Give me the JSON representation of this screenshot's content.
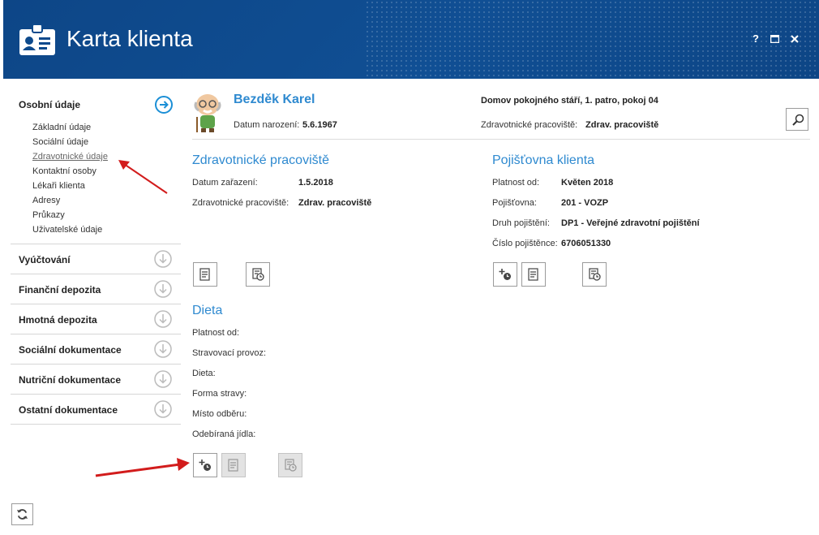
{
  "header": {
    "title": "Karta klienta",
    "help": "?",
    "maximize": "□",
    "close": "✕"
  },
  "sidebar": {
    "sections": [
      {
        "label": "Osobní údaje",
        "items": [
          "Základní údaje",
          "Sociální údaje",
          "Zdravotnické údaje",
          "Kontaktní osoby",
          "Lékaři klienta",
          "Adresy",
          "Průkazy",
          "Uživatelské údaje"
        ],
        "active": "Zdravotnické údaje"
      },
      {
        "label": "Vyúčtování"
      },
      {
        "label": "Finanční depozita"
      },
      {
        "label": "Hmotná depozita"
      },
      {
        "label": "Sociální dokumentace"
      },
      {
        "label": "Nutriční dokumentace"
      },
      {
        "label": "Ostatní dokumentace"
      }
    ]
  },
  "client": {
    "name": "Bezděk Karel",
    "dob_label": "Datum narození:",
    "dob": "5.6.1967",
    "location": "Domov pokojného stáří, 1. patro, pokoj 04",
    "workplace_label": "Zdravotnické pracoviště:",
    "workplace": "Zdrav. pracoviště"
  },
  "health": {
    "title": "Zdravotnické pracoviště",
    "date_label": "Datum zařazení:",
    "date": "1.5.2018",
    "wp_label": "Zdravotnické pracoviště:",
    "wp": "Zdrav. pracoviště"
  },
  "insurance": {
    "title": "Pojišťovna klienta",
    "valid_label": "Platnost od:",
    "valid": "Květen 2018",
    "company_label": "Pojišťovna:",
    "company": "201 - VOZP",
    "type_label": "Druh pojištění:",
    "type": "DP1 - Veřejné zdravotní pojištění",
    "number_label": "Číslo pojištěnce:",
    "number": "6706051330"
  },
  "diet": {
    "title": "Dieta",
    "fields": [
      "Platnost od:",
      "Stravovací provoz:",
      "Dieta:",
      "Forma stravy:",
      "Místo odběru:",
      "Odebíraná jídla:"
    ]
  },
  "colors": {
    "header": "#0e4a8c",
    "accent": "#2f8ad0",
    "arrow": "#d21c1c"
  }
}
